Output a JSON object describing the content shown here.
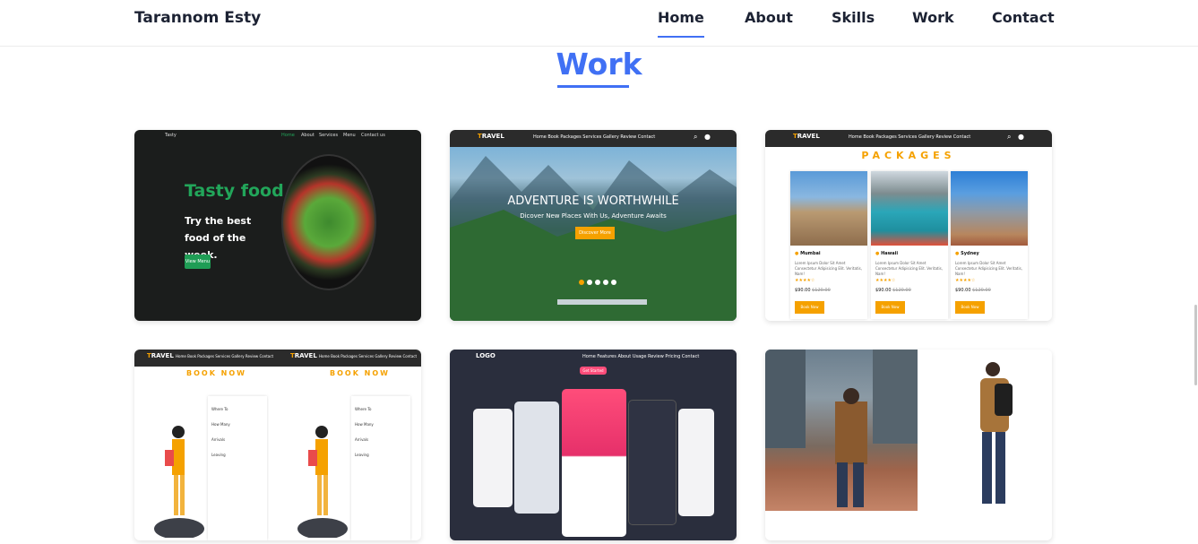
{
  "header": {
    "brand": "Tarannom Esty",
    "nav": [
      "Home",
      "About",
      "Skills",
      "Work",
      "Contact"
    ],
    "active": "Home"
  },
  "section": {
    "title": "Work"
  },
  "projects": {
    "tasty": {
      "nav": [
        "Tasty",
        "Home",
        "About",
        "Services",
        "Menu",
        "Contact us"
      ],
      "title": "Tasty food",
      "tagline": "Try the best food of the week.",
      "button": "View Menu"
    },
    "travel": {
      "logo_t": "T",
      "logo_rest": "RAVEL",
      "nav": "Home  Book  Packages  Services  Gallery  Review  Contact",
      "headline": "ADVENTURE IS WORTHWHILE",
      "subheadline": "Dicover New Places With Us, Adventure Awaits",
      "button": "Discover More"
    },
    "packages": {
      "heading": "PACKAGES",
      "items": [
        {
          "location": "Mumbai",
          "desc": "Lorem Ipsum Dolor Sit Amet Consectetur Adipisicing Elit. Veritatis, Nam!",
          "stars": "★★★★☆",
          "price": "$90.00",
          "old": "$120.00",
          "button": "Book Now"
        },
        {
          "location": "Hawaii",
          "desc": "Lorem Ipsum Dolor Sit Amet Consectetur Adipisicing Elit. Veritatis, Nam!",
          "stars": "★★★★☆",
          "price": "$90.00",
          "old": "$120.00",
          "button": "Book Now"
        },
        {
          "location": "Sydney",
          "desc": "Lorem Ipsum Dolor Sit Amet Consectetur Adipisicing Elit. Veritatis, Nam!",
          "stars": "★★★★☆",
          "price": "$90.00",
          "old": "$120.00",
          "button": "Book Now"
        }
      ]
    },
    "booking": {
      "heading": "BOOK NOW",
      "fields": [
        "Where To",
        "How Many",
        "Arrivals",
        "Leaving"
      ]
    },
    "app": {
      "logo": "LOGO",
      "nav": "Home  Features  About  Usage  Review  Pricing  Contact",
      "button": "Get Started"
    }
  },
  "colors": {
    "accent": "#4070f4",
    "orange": "#f5a100",
    "green": "#22a65a"
  }
}
